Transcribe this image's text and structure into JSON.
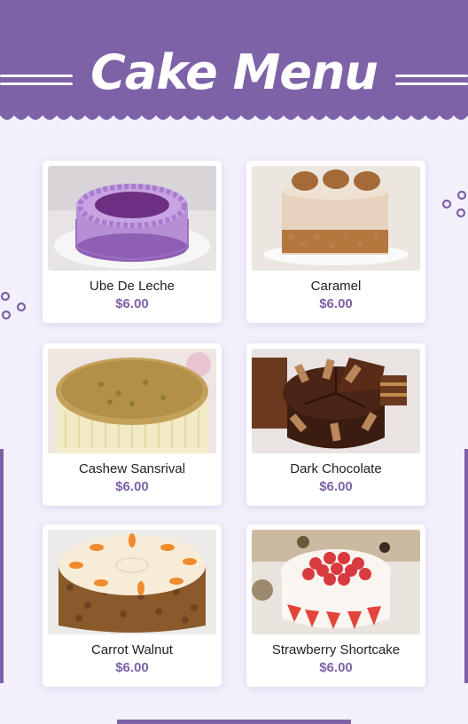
{
  "title": "Cake Menu",
  "colors": {
    "accent": "#7d62a8",
    "background": "#f3f0fb",
    "price": "#7d62a8"
  },
  "items": [
    {
      "name": "Ube De Leche",
      "price": "$6.00"
    },
    {
      "name": "Caramel",
      "price": "$6.00"
    },
    {
      "name": "Cashew Sansrival",
      "price": "$6.00"
    },
    {
      "name": "Dark Chocolate",
      "price": "$6.00"
    },
    {
      "name": "Carrot Walnut",
      "price": "$6.00"
    },
    {
      "name": "Strawberry Shortcake",
      "price": "$6.00"
    }
  ]
}
